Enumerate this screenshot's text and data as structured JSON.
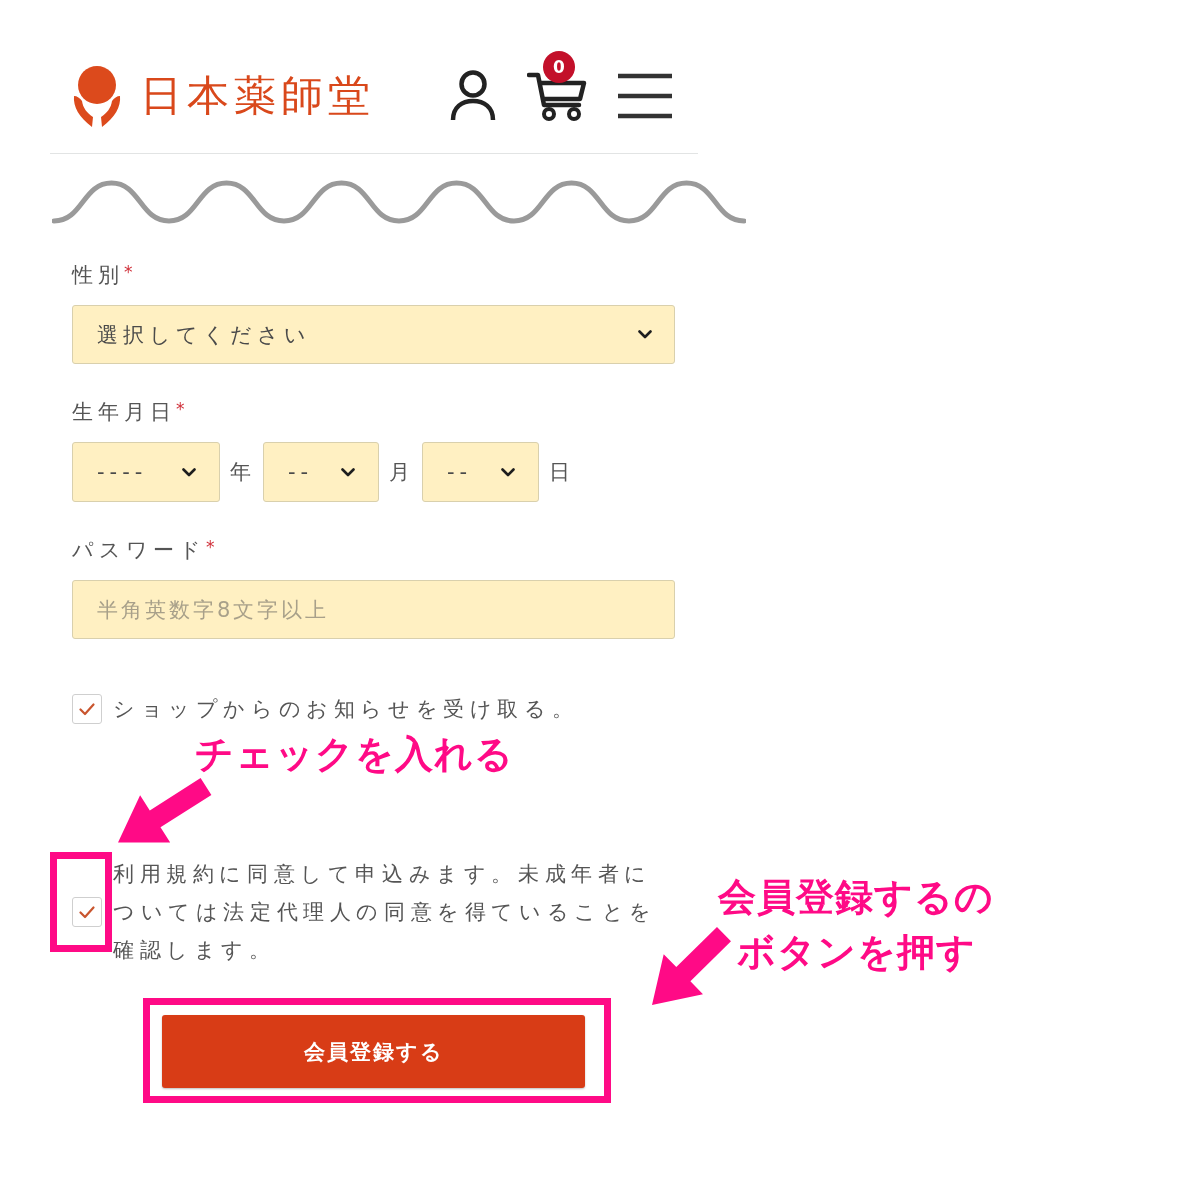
{
  "header": {
    "logo": {
      "text": "日本薬師堂"
    },
    "cart": {
      "badge": "0"
    }
  },
  "form": {
    "fields": [
      {
        "kind": "select",
        "label": "性別",
        "required_mark": "*",
        "value": "選択してください"
      },
      {
        "kind": "date",
        "label": "生年月日",
        "required_mark": "*",
        "parts": [
          {
            "value": "----",
            "unit": "年"
          },
          {
            "value": "--",
            "unit": "月"
          },
          {
            "value": "--",
            "unit": "日"
          }
        ]
      },
      {
        "kind": "password",
        "label": "パスワード",
        "required_mark": "*",
        "placeholder": "半角英数字8文字以上"
      }
    ],
    "consents": [
      {
        "label": "ショップからのお知らせを受け取る。",
        "checked": true,
        "highlighted": false
      },
      {
        "label": "利用規約に同意して申込みます。未成年者については法定代理人の同意を得ていることを確認します。",
        "checked": true,
        "highlighted": true
      }
    ],
    "submit": {
      "label": "会員登録する",
      "highlighted": true
    }
  },
  "annotations": [
    {
      "lines": [
        "チェックを入れる"
      ]
    },
    {
      "lines": [
        "会員登録するの",
        "ボタンを押す"
      ]
    }
  ]
}
